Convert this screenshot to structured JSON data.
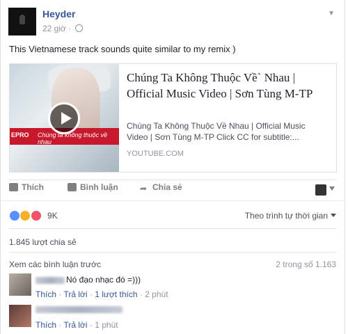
{
  "post": {
    "author": "Heyder",
    "time": "22 giờ ·",
    "text": "This Vietnamese track sounds quite similar to my remix )"
  },
  "link": {
    "title": "Chúng Ta Không Thuộc Về` Nhau | Official Music Video | Sơn Tùng M-TP",
    "description": "Chúng Ta Không Thuộc Về Nhau | Official Music Video | Sơn Tùng M-TP Click CC for subtitle:...",
    "domain": "YOUTUBE.COM",
    "thumb_banner_left": "EPRO",
    "thumb_banner_text": "Chúng ta không thuộc về nhau"
  },
  "actions": {
    "like": "Thích",
    "comment": "Bình luận",
    "share": "Chia sẻ"
  },
  "reactions": {
    "count": "9K",
    "sort_label": "Theo trình tự thời gian"
  },
  "shares": "1.845 lượt chia sẻ",
  "comments": {
    "view_previous": "Xem các bình luận trước",
    "count": "2 trong số 1.163",
    "items": [
      {
        "text": "Nó đạo nhạc đó =)))",
        "like": "Thích",
        "reply": "Trả lời",
        "likes": "1 lượt thích",
        "time": "2 phút"
      },
      {
        "like": "Thích",
        "reply": "Trả lời",
        "time": "1 phút"
      }
    ]
  },
  "icons": {
    "menu": "chevron-down-icon",
    "privacy": "globe-icon",
    "play": "play-icon",
    "like": "thumbs-up-icon",
    "comment": "speech-bubble-icon",
    "share": "share-arrow-icon"
  },
  "colors": {
    "link_blue": "#365899",
    "meta_gray": "#90949c",
    "like_blue": "#5890ff",
    "haha_yellow": "#f7b125",
    "love_red": "#f25268",
    "youtube_red": "#c8192c"
  }
}
